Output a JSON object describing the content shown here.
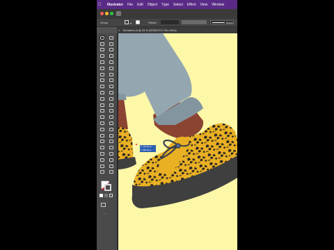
{
  "menubar": {
    "apple_icon": "apple-icon",
    "items": [
      "Illustrator",
      "File",
      "Edit",
      "Object",
      "Type",
      "Select",
      "Effect",
      "View",
      "Window"
    ]
  },
  "control_bar": {
    "selection_label": "Group",
    "stroke_label": "Stroke:",
    "brush_label": "Basic"
  },
  "document_tab": {
    "title": "Sneakers.ai @ 25 % (RGB/CPU Trim View)"
  },
  "measure_tooltip": {
    "line1": "X: 722.35 px",
    "line2": "Y: 984.63 px"
  },
  "colors": {
    "accent": "#5a2b86",
    "canvas": "#fdf7a8",
    "pants": "#94a7b0",
    "shoe": "#e9b024",
    "skin": "#8b4431",
    "sole": "#3f3f3f"
  }
}
